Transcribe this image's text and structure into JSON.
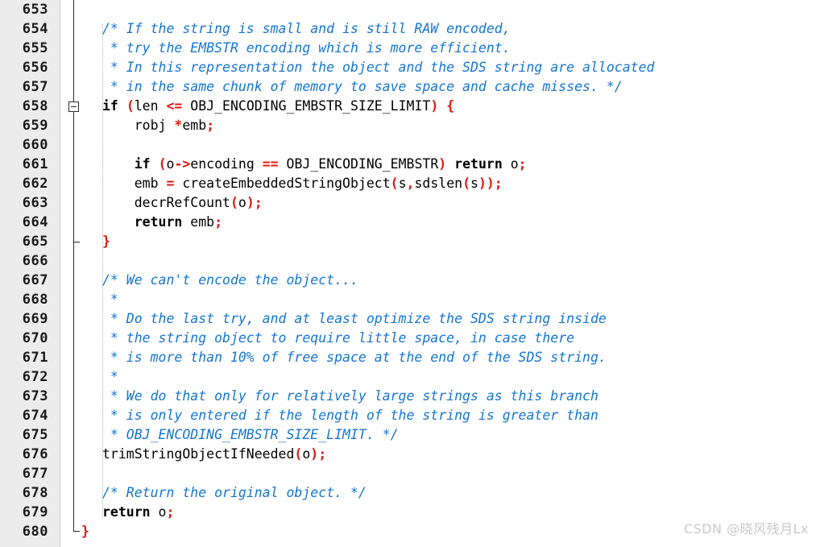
{
  "editor": {
    "first_line_number": 653,
    "line_height_px": 24,
    "colors": {
      "background": "#ffffff",
      "gutter_background": "#ececec",
      "gutter_text": "#1a1a1a",
      "comment": "#1874cd",
      "punctuation": "#e3170d",
      "keyword": "#000000",
      "plain_text": "#000000",
      "indent_guide": "#b4b4b4",
      "fold_line": "#2b2b2b",
      "watermark": "#c9c9c9"
    }
  },
  "gutter": {
    "line_numbers": [
      "653",
      "654",
      "655",
      "656",
      "657",
      "658",
      "659",
      "660",
      "661",
      "662",
      "663",
      "664",
      "665",
      "666",
      "667",
      "668",
      "669",
      "670",
      "671",
      "672",
      "673",
      "674",
      "675",
      "676",
      "677",
      "678",
      "679",
      "680"
    ],
    "fold_markers": [
      {
        "name": "fold-collapse-box",
        "line": "658",
        "state": "expanded",
        "glyph": "minus-box"
      },
      {
        "name": "fold-range-tick",
        "line": "665",
        "glyph": "tick"
      },
      {
        "name": "fold-range-end",
        "line": "680",
        "glyph": "l-corner"
      }
    ]
  },
  "code": {
    "lines": [
      {
        "number": "653",
        "tokens": []
      },
      {
        "number": "654",
        "tokens": [
          {
            "t": "comment",
            "s": "/* If the string is small and is still RAW encoded,"
          }
        ]
      },
      {
        "number": "655",
        "tokens": [
          {
            "t": "comment",
            "s": " * try the EMBSTR encoding which is more efficient."
          }
        ]
      },
      {
        "number": "656",
        "tokens": [
          {
            "t": "comment",
            "s": " * In this representation the object and the SDS string are allocated"
          }
        ]
      },
      {
        "number": "657",
        "tokens": [
          {
            "t": "comment",
            "s": " * in the same chunk of memory to save space and cache misses. */"
          }
        ]
      },
      {
        "number": "658",
        "tokens": [
          {
            "t": "kw",
            "s": "if"
          },
          {
            "t": "plain",
            "s": " "
          },
          {
            "t": "punc",
            "s": "("
          },
          {
            "t": "plain",
            "s": "len "
          },
          {
            "t": "punc",
            "s": "<="
          },
          {
            "t": "plain",
            "s": " OBJ_ENCODING_EMBSTR_SIZE_LIMIT"
          },
          {
            "t": "punc",
            "s": ")"
          },
          {
            "t": "plain",
            "s": " "
          },
          {
            "t": "punc",
            "s": "{"
          }
        ]
      },
      {
        "number": "659",
        "tokens": [
          {
            "t": "plain",
            "s": "    robj "
          },
          {
            "t": "punc",
            "s": "*"
          },
          {
            "t": "plain",
            "s": "emb"
          },
          {
            "t": "punc",
            "s": ";"
          }
        ]
      },
      {
        "number": "660",
        "tokens": []
      },
      {
        "number": "661",
        "tokens": [
          {
            "t": "plain",
            "s": "    "
          },
          {
            "t": "kw",
            "s": "if"
          },
          {
            "t": "plain",
            "s": " "
          },
          {
            "t": "punc",
            "s": "("
          },
          {
            "t": "plain",
            "s": "o"
          },
          {
            "t": "punc",
            "s": "->"
          },
          {
            "t": "plain",
            "s": "encoding "
          },
          {
            "t": "punc",
            "s": "=="
          },
          {
            "t": "plain",
            "s": " OBJ_ENCODING_EMBSTR"
          },
          {
            "t": "punc",
            "s": ")"
          },
          {
            "t": "plain",
            "s": " "
          },
          {
            "t": "kw",
            "s": "return"
          },
          {
            "t": "plain",
            "s": " o"
          },
          {
            "t": "punc",
            "s": ";"
          }
        ]
      },
      {
        "number": "662",
        "tokens": [
          {
            "t": "plain",
            "s": "    emb "
          },
          {
            "t": "punc",
            "s": "="
          },
          {
            "t": "plain",
            "s": " createEmbeddedStringObject"
          },
          {
            "t": "punc",
            "s": "("
          },
          {
            "t": "plain",
            "s": "s"
          },
          {
            "t": "punc",
            "s": ","
          },
          {
            "t": "plain",
            "s": "sdslen"
          },
          {
            "t": "punc",
            "s": "("
          },
          {
            "t": "plain",
            "s": "s"
          },
          {
            "t": "punc",
            "s": "));"
          }
        ]
      },
      {
        "number": "663",
        "tokens": [
          {
            "t": "plain",
            "s": "    decrRefCount"
          },
          {
            "t": "punc",
            "s": "("
          },
          {
            "t": "plain",
            "s": "o"
          },
          {
            "t": "punc",
            "s": ");"
          }
        ]
      },
      {
        "number": "664",
        "tokens": [
          {
            "t": "plain",
            "s": "    "
          },
          {
            "t": "kw",
            "s": "return"
          },
          {
            "t": "plain",
            "s": " emb"
          },
          {
            "t": "punc",
            "s": ";"
          }
        ]
      },
      {
        "number": "665",
        "tokens": [
          {
            "t": "punc",
            "s": "}"
          }
        ]
      },
      {
        "number": "666",
        "tokens": []
      },
      {
        "number": "667",
        "tokens": [
          {
            "t": "comment",
            "s": "/* We can't encode the object..."
          }
        ]
      },
      {
        "number": "668",
        "tokens": [
          {
            "t": "comment",
            "s": " *"
          }
        ]
      },
      {
        "number": "669",
        "tokens": [
          {
            "t": "comment",
            "s": " * Do the last try, and at least optimize the SDS string inside"
          }
        ]
      },
      {
        "number": "670",
        "tokens": [
          {
            "t": "comment",
            "s": " * the string object to require little space, in case there"
          }
        ]
      },
      {
        "number": "671",
        "tokens": [
          {
            "t": "comment",
            "s": " * is more than 10% of free space at the end of the SDS string."
          }
        ]
      },
      {
        "number": "672",
        "tokens": [
          {
            "t": "comment",
            "s": " *"
          }
        ]
      },
      {
        "number": "673",
        "tokens": [
          {
            "t": "comment",
            "s": " * We do that only for relatively large strings as this branch"
          }
        ]
      },
      {
        "number": "674",
        "tokens": [
          {
            "t": "comment",
            "s": " * is only entered if the length of the string is greater than"
          }
        ]
      },
      {
        "number": "675",
        "tokens": [
          {
            "t": "comment",
            "s": " * OBJ_ENCODING_EMBSTR_SIZE_LIMIT. */"
          }
        ]
      },
      {
        "number": "676",
        "tokens": [
          {
            "t": "plain",
            "s": "trimStringObjectIfNeeded"
          },
          {
            "t": "punc",
            "s": "("
          },
          {
            "t": "plain",
            "s": "o"
          },
          {
            "t": "punc",
            "s": ");"
          }
        ]
      },
      {
        "number": "677",
        "tokens": []
      },
      {
        "number": "678",
        "tokens": [
          {
            "t": "comment",
            "s": "/* Return the original object. */"
          }
        ]
      },
      {
        "number": "679",
        "tokens": [
          {
            "t": "kw",
            "s": "return"
          },
          {
            "t": "plain",
            "s": " o"
          },
          {
            "t": "punc",
            "s": ";"
          }
        ]
      },
      {
        "number": "680",
        "tokens": [
          {
            "t": "punc",
            "s": "}",
            "outdent": true
          }
        ]
      }
    ]
  },
  "watermark": {
    "text": "CSDN @晓风残月Lx"
  }
}
